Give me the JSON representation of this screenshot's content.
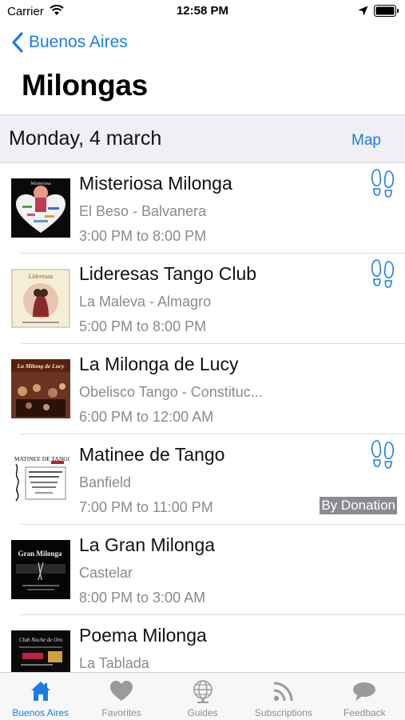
{
  "status_bar": {
    "carrier": "Carrier",
    "time": "12:58 PM"
  },
  "nav": {
    "back_label": "Buenos Aires",
    "title": "Milongas"
  },
  "section": {
    "date": "Monday, 4 march",
    "map_label": "Map"
  },
  "milongas": [
    {
      "title": "Misteriosa Milonga",
      "venue": "El Beso - Balvanera",
      "time": "3:00 PM to 8:00 PM",
      "footprints": true,
      "badge": ""
    },
    {
      "title": "Lideresas Tango Club",
      "venue": "La Maleva - Almagro",
      "time": "5:00 PM to 8:00 PM",
      "footprints": true,
      "badge": ""
    },
    {
      "title": "La Milonga de Lucy",
      "venue": "Obelisco Tango - Constituc...",
      "time": "6:00 PM to 12:00 AM",
      "footprints": false,
      "badge": ""
    },
    {
      "title": "Matinee de Tango",
      "venue": "Banfield",
      "time": "7:00 PM to 11:00 PM",
      "footprints": true,
      "badge": "By Donation"
    },
    {
      "title": "La Gran Milonga",
      "venue": "Castelar",
      "time": "8:00 PM to 3:00 AM",
      "footprints": false,
      "badge": ""
    },
    {
      "title": "Poema Milonga",
      "venue": "La Tablada",
      "time": "",
      "footprints": false,
      "badge": ""
    }
  ],
  "thumbnails": [
    {
      "logo_text": "Misteriosa"
    },
    {
      "logo_text": "Lideresas"
    },
    {
      "logo_text": "La Milong de Lucy"
    },
    {
      "logo_text": "MATINEE DE TANGO"
    },
    {
      "logo_text": "Gran Milonga"
    },
    {
      "logo_text": "Club Noche de Oro"
    }
  ],
  "tabs": [
    {
      "label": "Buenos Aires",
      "icon": "home-icon",
      "active": true
    },
    {
      "label": "Favorites",
      "icon": "heart-icon",
      "active": false
    },
    {
      "label": "Guides",
      "icon": "globe-icon",
      "active": false
    },
    {
      "label": "Subscriptions",
      "icon": "rss-icon",
      "active": false
    },
    {
      "label": "Feedback",
      "icon": "speech-bubble-icon",
      "active": false
    }
  ],
  "colors": {
    "accent": "#1a7ce6",
    "secondary_text": "#8a8a8f",
    "section_bg": "#efeff4",
    "badge_bg": "#8a8a8f"
  }
}
